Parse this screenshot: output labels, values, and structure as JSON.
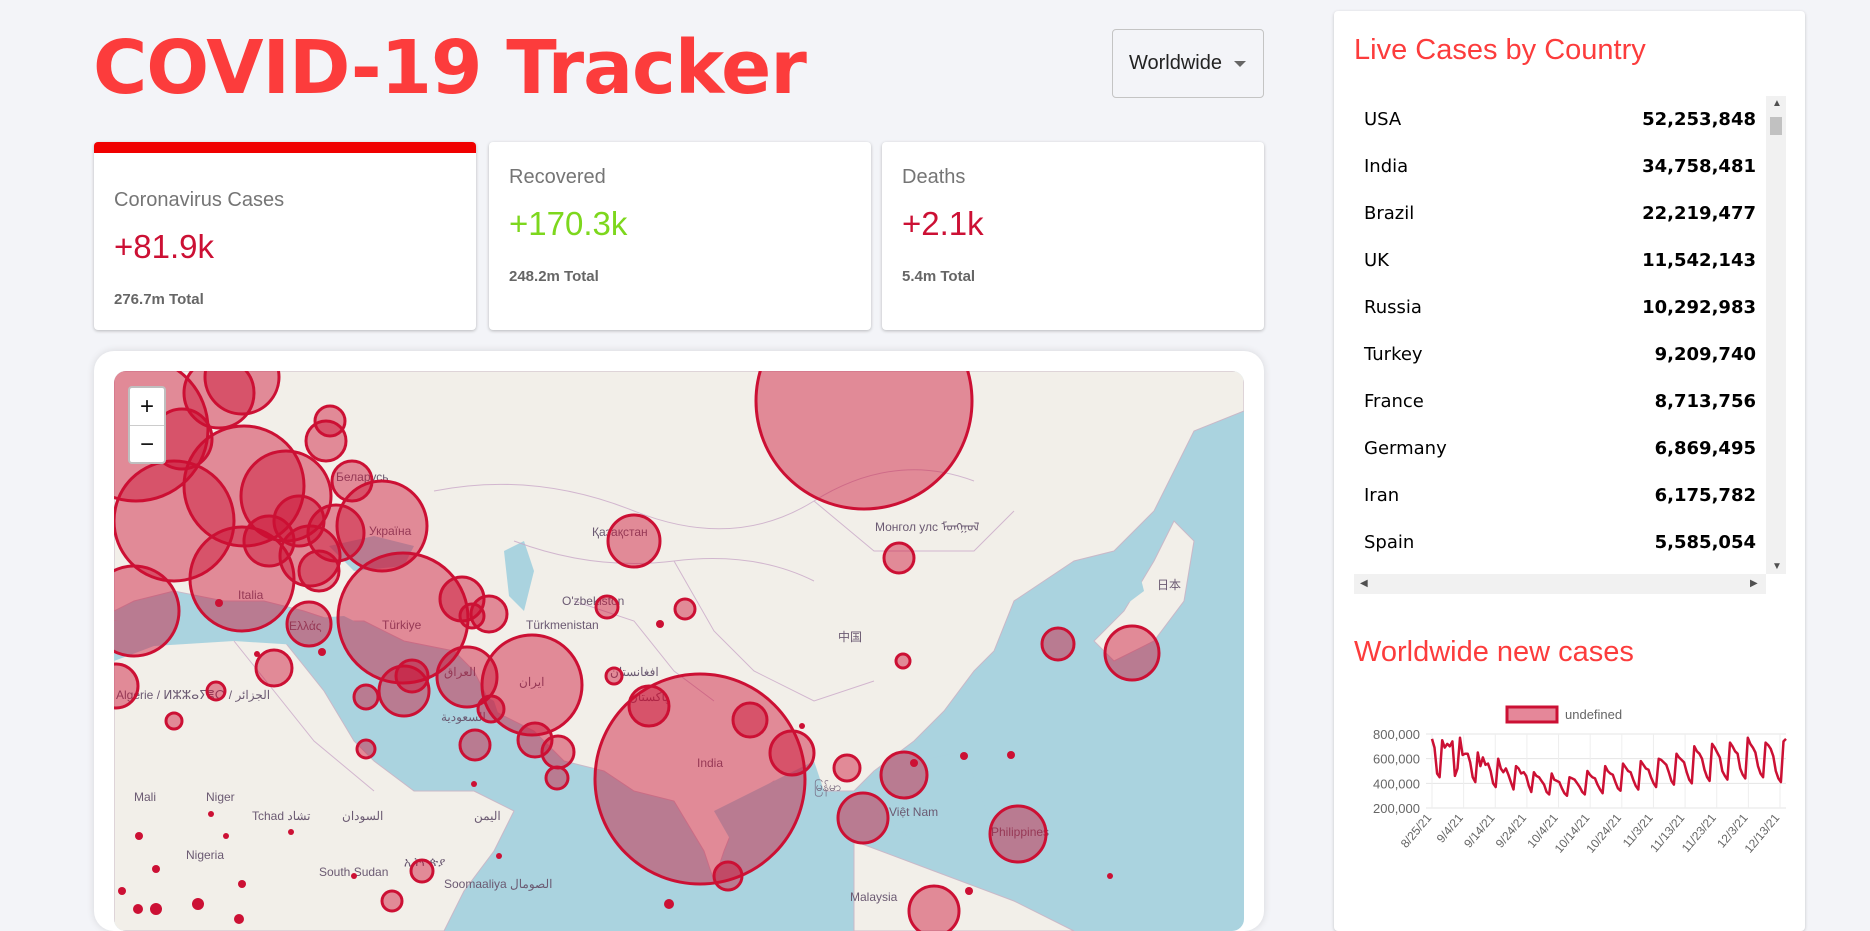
{
  "header": {
    "title": "COVID-19 Tracker"
  },
  "country_select": {
    "selected": "Worldwide"
  },
  "stats": [
    {
      "label": "Coronavirus Cases",
      "value": "+81.9k",
      "total": "276.7m Total",
      "color": "#cc1034"
    },
    {
      "label": "Recovered",
      "value": "+170.3k",
      "total": "248.2m Total",
      "color": "#7dd71d"
    },
    {
      "label": "Deaths",
      "value": "+2.1k",
      "total": "5.4m Total",
      "color": "#cc1034"
    }
  ],
  "map": {
    "zoom_in": "+",
    "zoom_out": "−",
    "place_labels": {
      "india": "India",
      "kazakhstan": "Қазақстан",
      "mongolia": "Монгол улс ᠮᠣᠩᠭᠣᠯ",
      "china": "中国",
      "japan": "日本",
      "uzbekistan": "O'zbekiston",
      "turkmenistan": "Türkmenistan",
      "turkey": "Türkiye",
      "ukraine": "Україна",
      "belarus": "Беларусь",
      "greece": "Ελλάς",
      "italy": "Italia",
      "iran": "ایران",
      "iraq": "العراق",
      "saudi": "السعودية",
      "afghanistan": "افغانستان",
      "pakistan": "پاکستان",
      "algeria": "Algérie / ⵍⵣⵣⴰⵢⴻⵔ / الجزائر",
      "mali": "Mali",
      "niger": "Niger",
      "tchad": "Tchad تشاد",
      "sudan": "السودان",
      "yemen": "اليمن",
      "nigeria": "Nigeria",
      "ethiopia": "ኢትዮጵያ",
      "south_sudan": "South Sudan",
      "somalia": "Soomaaliya الصومال",
      "myanmar": "မြန်မာ",
      "vietnam": "Việt Nam",
      "philippines": "Philippines",
      "malaysia": "Malaysia"
    }
  },
  "sidebar": {
    "table_title": "Live Cases by Country",
    "countries": [
      {
        "country": "USA",
        "cases": "52,253,848"
      },
      {
        "country": "India",
        "cases": "34,758,481"
      },
      {
        "country": "Brazil",
        "cases": "22,219,477"
      },
      {
        "country": "UK",
        "cases": "11,542,143"
      },
      {
        "country": "Russia",
        "cases": "10,292,983"
      },
      {
        "country": "Turkey",
        "cases": "9,209,740"
      },
      {
        "country": "France",
        "cases": "8,713,756"
      },
      {
        "country": "Germany",
        "cases": "6,869,495"
      },
      {
        "country": "Iran",
        "cases": "6,175,782"
      },
      {
        "country": "Spain",
        "cases": "5,585,054"
      }
    ],
    "chart_title": "Worldwide new cases"
  },
  "chart_data": {
    "type": "line",
    "title": "",
    "legend": "undefined",
    "x_tick_labels": [
      "8/25/21",
      "9/4/21",
      "9/14/21",
      "9/24/21",
      "10/4/21",
      "10/14/21",
      "10/24/21",
      "11/3/21",
      "11/13/21",
      "11/23/21",
      "12/3/21",
      "12/13/21"
    ],
    "ylim": [
      200000,
      800000
    ],
    "y_tick_labels": [
      "800,000",
      "600,000",
      "400,000",
      "200,000"
    ],
    "series": [
      {
        "name": "undefined",
        "x_start": "8/25/21",
        "values": [
          760000,
          690000,
          480000,
          450000,
          750000,
          690000,
          720000,
          700000,
          740000,
          460000,
          520000,
          770000,
          630000,
          640000,
          640000,
          570000,
          450000,
          410000,
          650000,
          540000,
          610000,
          550000,
          560000,
          500000,
          400000,
          370000,
          600000,
          520000,
          490000,
          520000,
          470000,
          410000,
          350000,
          540000,
          520000,
          480000,
          490000,
          460000,
          380000,
          330000,
          490000,
          460000,
          450000,
          420000,
          390000,
          330000,
          310000,
          480000,
          430000,
          420000,
          410000,
          360000,
          320000,
          300000,
          450000,
          440000,
          430000,
          400000,
          370000,
          330000,
          310000,
          500000,
          470000,
          450000,
          440000,
          390000,
          350000,
          320000,
          540000,
          500000,
          480000,
          470000,
          410000,
          360000,
          340000,
          560000,
          530000,
          500000,
          490000,
          430000,
          380000,
          350000,
          580000,
          550000,
          520000,
          510000,
          450000,
          400000,
          370000,
          600000,
          590000,
          570000,
          550000,
          490000,
          420000,
          390000,
          640000,
          610000,
          590000,
          570000,
          490000,
          430000,
          400000,
          700000,
          660000,
          640000,
          600000,
          510000,
          450000,
          420000,
          720000,
          690000,
          650000,
          610000,
          500000,
          460000,
          430000,
          730000,
          700000,
          660000,
          640000,
          520000,
          470000,
          440000,
          770000,
          720000,
          690000,
          650000,
          540000,
          480000,
          450000,
          730000,
          710000,
          680000,
          620000,
          500000,
          440000,
          410000,
          740000,
          760000
        ]
      }
    ],
    "color": "#cc1034"
  }
}
